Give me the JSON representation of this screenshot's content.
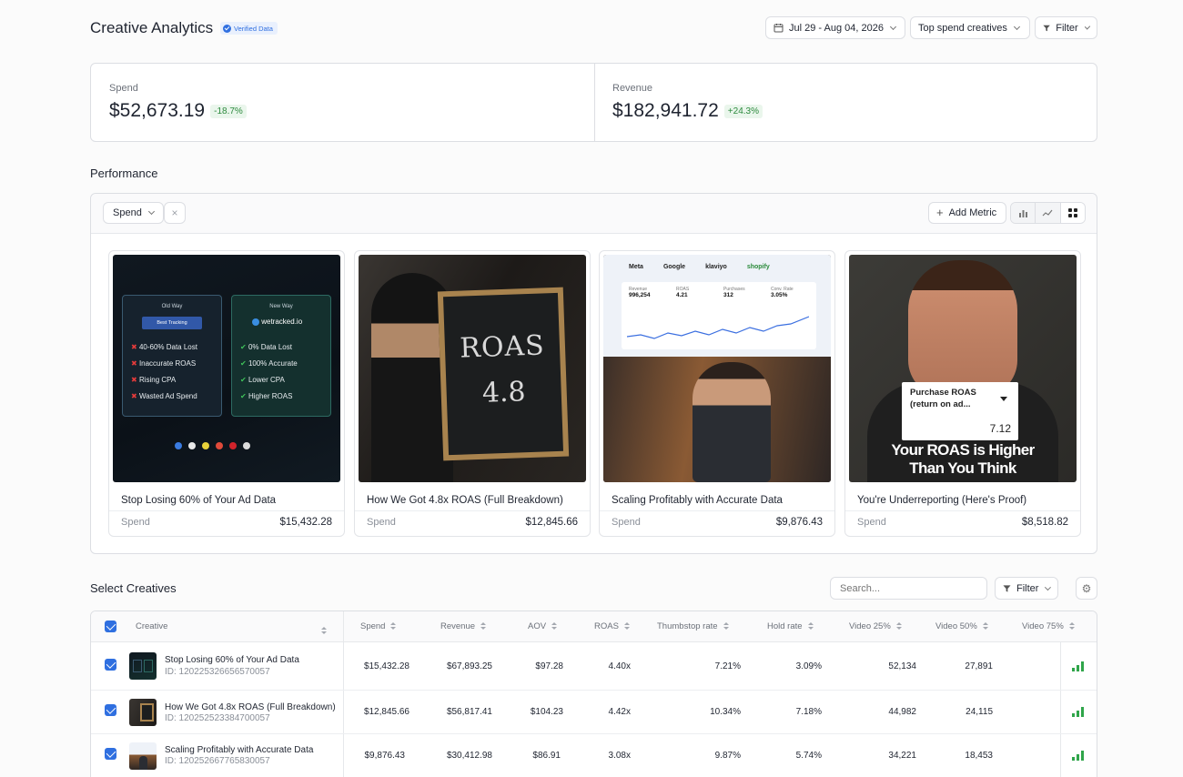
{
  "header": {
    "title": "Creative Analytics",
    "badge": "Verified Data",
    "date_range": "Jul 29 - Aug 04, 2026",
    "view_select": "Top spend creatives",
    "filter_label": "Filter"
  },
  "kpis": [
    {
      "label": "Spend",
      "value": "$52,673.19",
      "delta": "-18.7%"
    },
    {
      "label": "Revenue",
      "value": "$182,941.72",
      "delta": "+24.3%"
    }
  ],
  "performance": {
    "title": "Performance",
    "metric_select": "Spend",
    "remove_icon": "×",
    "add_metric": "Add Metric",
    "view_toggles": [
      "bar-chart-icon",
      "line-chart-icon",
      "grid-icon"
    ],
    "cards": [
      {
        "title": "Stop Losing 60% of Your Ad Data",
        "spend_label": "Spend",
        "spend": "$15,432.28",
        "thumb": {
          "old_way": "Old Way",
          "new_way": "New Way",
          "old_tag": "Best Tracking",
          "new_tag": "wetracked.io",
          "old_items": [
            "40-60% Data Lost",
            "Inaccurate ROAS",
            "Rising CPA",
            "Wasted Ad Spend"
          ],
          "new_items": [
            "0% Data Lost",
            "100% Accurate",
            "Lower CPA",
            "Higher ROAS"
          ]
        }
      },
      {
        "title": "How We Got 4.8x ROAS (Full Breakdown)",
        "spend_label": "Spend",
        "spend": "$12,845.66",
        "thumb": {
          "line1": "ROAS",
          "line2": "4.8"
        }
      },
      {
        "title": "Scaling Profitably with Accurate Data",
        "spend_label": "Spend",
        "spend": "$9,876.43",
        "thumb": {
          "brands": [
            "Meta",
            "Google",
            "klaviyo",
            "shopify"
          ],
          "stat_labels": [
            "Revenue",
            "ROAS",
            "Purchases",
            "Conv. Rate"
          ],
          "stat_values": [
            "996,254",
            "4.21",
            "312",
            "3.05%"
          ]
        }
      },
      {
        "title": "You're Underreporting (Here's Proof)",
        "spend_label": "Spend",
        "spend": "$8,518.82",
        "thumb": {
          "card_title": "Purchase ROAS (return on ad...",
          "card_value": "7.12",
          "caption1": "Your ROAS is Higher",
          "caption2": "Than You Think"
        }
      }
    ]
  },
  "table": {
    "title": "Select Creatives",
    "search_placeholder": "Search...",
    "filter_label": "Filter",
    "columns": [
      "Creative",
      "Spend",
      "Revenue",
      "AOV",
      "ROAS",
      "Thumbstop rate",
      "Hold rate",
      "Video 25%",
      "Video 50%",
      "Video 75%"
    ],
    "rows": [
      {
        "name": "Stop Losing 60% of Your Ad Data",
        "id": "ID: 120225326656570057",
        "cells": [
          "$15,432.28",
          "$67,893.25",
          "$97.28",
          "4.40x",
          "7.21%",
          "3.09%",
          "52,134",
          "27,891"
        ]
      },
      {
        "name": "How We Got 4.8x ROAS (Full Breakdown)",
        "id": "ID: 120252523384700057",
        "cells": [
          "$12,845.66",
          "$56,817.41",
          "$104.23",
          "4.42x",
          "10.34%",
          "7.18%",
          "44,982",
          "24,115"
        ]
      },
      {
        "name": "Scaling Profitably with Accurate Data",
        "id": "ID: 120252667765830057",
        "cells": [
          "$9,876.43",
          "$30,412.98",
          "$86.91",
          "3.08x",
          "9.87%",
          "5.74%",
          "34,221",
          "18,453"
        ]
      }
    ]
  },
  "colors": {
    "accent": "#2f6fe0",
    "positive": "#2d8a3e",
    "negative": "#2d8a3e"
  }
}
